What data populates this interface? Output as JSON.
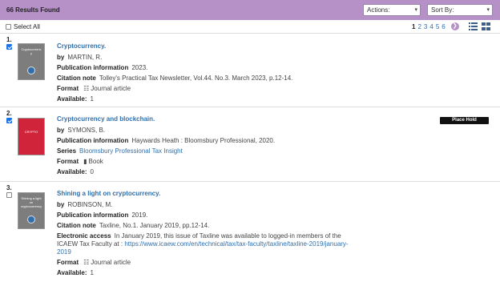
{
  "header": {
    "results_count": "66 Results Found",
    "actions_label": "Actions:",
    "sortby_label": "Sort By:"
  },
  "toolbar": {
    "select_all": "Select All",
    "pages": [
      "1",
      "2",
      "3",
      "4",
      "5",
      "6"
    ],
    "current_page": "1"
  },
  "records": [
    {
      "number": "1.",
      "checked": true,
      "title": "Cryptocurrency.",
      "cover_title": "Cryptocurrenc y",
      "by_label": "by",
      "by_value": "MARTIN, R.",
      "pub_label": "Publication information",
      "pub_value": "2023.",
      "citation_label": "Citation note",
      "citation_value": "Tolley's Practical Tax Newsletter, Vol.44. No.3. March 2023, p.12-14.",
      "format_label": "Format",
      "format_value": "Journal article",
      "available_label": "Available:",
      "available_value": "1"
    },
    {
      "number": "2.",
      "checked": true,
      "title": "Cryptocurrency and blockchain.",
      "cover_title": "CRYPTO",
      "by_label": "by",
      "by_value": "SYMONS, B.",
      "pub_label": "Publication information",
      "pub_value": "Haywards Heath : Bloomsbury Professional, 2020.",
      "series_label": "Series",
      "series_value": "Bloomsbury Professional Tax Insight",
      "format_label": "Format",
      "format_value": "Book",
      "available_label": "Available:",
      "available_value": "0",
      "hold_label": "Place Hold"
    },
    {
      "number": "3.",
      "checked": false,
      "title": "Shining a light on cryptocurrency.",
      "cover_title": "Shining a light on cryptocurrency",
      "by_label": "by",
      "by_value": "ROBINSON, M.",
      "pub_label": "Publication information",
      "pub_value": "2019.",
      "citation_label": "Citation note",
      "citation_value": "Taxline, No.1. January 2019, pp.12-14.",
      "access_label": "Electronic access",
      "access_line1": "In January 2019, this issue of Taxline was available to logged-in members of the",
      "access_line2": "ICAEW Tax Faculty at :",
      "access_url_part1": "https://www.icaew.com/en/technical/tax/tax-faculty/taxline/taxline-2019/january-",
      "access_url_part2": "2019",
      "format_label": "Format",
      "format_value": "Journal article",
      "available_label": "Available:",
      "available_value": "1"
    }
  ],
  "colors": {
    "header_bg": "#b591c8",
    "link": "#2f6fad",
    "hold_button": "#111111",
    "cover_red": "#d0243a",
    "cover_grey": "#7d7d7d"
  }
}
